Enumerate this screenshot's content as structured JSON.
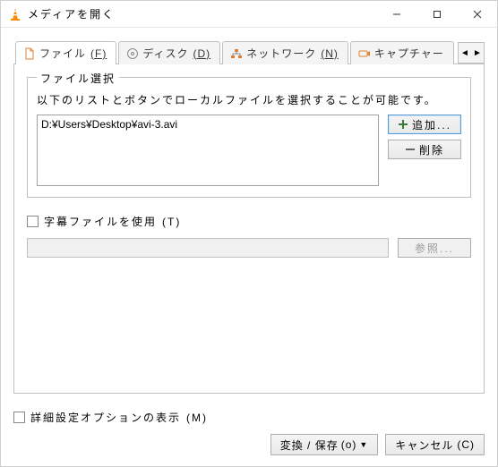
{
  "window": {
    "title": "メディアを開く"
  },
  "tabs": {
    "file": {
      "label": "ファイル",
      "mnemonic": "(F)"
    },
    "disc": {
      "label": "ディスク",
      "mnemonic": "(D)"
    },
    "network": {
      "label": "ネットワーク",
      "mnemonic": "(N)"
    },
    "capture": {
      "label": "キャプチャー"
    }
  },
  "file_section": {
    "legend": "ファイル選択",
    "instruction": "以下のリストとボタンでローカルファイルを選択することが可能です。",
    "files": [
      "D:¥Users¥Desktop¥avi-3.avi"
    ],
    "add_label": "追加...",
    "remove_label": "削除"
  },
  "subtitle": {
    "use_label": "字幕ファイルを使用",
    "use_mnemonic": "(T)",
    "browse_label": "参照..."
  },
  "footer": {
    "advanced_label": "詳細設定オプションの表示",
    "advanced_mnemonic": "(M)",
    "convert_label": "変換 / 保存",
    "convert_mnemonic": "(o)",
    "cancel_label": "キャンセル",
    "cancel_mnemonic": "(C)"
  }
}
